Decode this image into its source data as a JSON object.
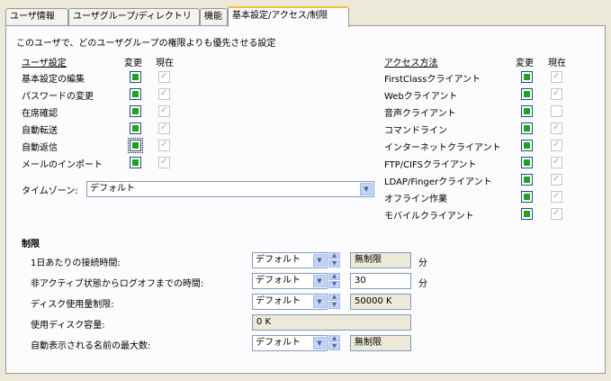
{
  "tabs": [
    {
      "label": "ユーザ情報"
    },
    {
      "label": "ユーザグループ/ディレクトリ"
    },
    {
      "label": "機能"
    },
    {
      "label": "基本設定/アクセス/制限"
    }
  ],
  "intro_text": "このユーザで、どのユーザグループの権限よりも優先させる設定",
  "user_settings": {
    "header": "ユーザ設定",
    "change_header": "変更",
    "current_header": "現在",
    "items": [
      {
        "label": "基本設定の編集",
        "change": true,
        "current": true
      },
      {
        "label": "パスワードの変更",
        "change": true,
        "current": true
      },
      {
        "label": "在席確認",
        "change": true,
        "current": true
      },
      {
        "label": "自動転送",
        "change": true,
        "current": true
      },
      {
        "label": "自動返信",
        "change": true,
        "current": true
      },
      {
        "label": "メールのインポート",
        "change": true,
        "current": true
      }
    ]
  },
  "access": {
    "header": "アクセス方法",
    "change_header": "変更",
    "current_header": "現在",
    "items": [
      {
        "label": "FirstClassクライアント",
        "change": true,
        "current": true
      },
      {
        "label": "Webクライアント",
        "change": true,
        "current": true
      },
      {
        "label": "音声クライアント",
        "change": true,
        "current": false
      },
      {
        "label": "コマンドライン",
        "change": true,
        "current": true
      },
      {
        "label": "インターネットクライアント",
        "change": true,
        "current": true
      },
      {
        "label": "FTP/CIFSクライアント",
        "change": true,
        "current": true
      },
      {
        "label": "LDAP/Fingerクライアント",
        "change": true,
        "current": true
      },
      {
        "label": "オフライン作業",
        "change": true,
        "current": true
      },
      {
        "label": "モバイルクライアント",
        "change": true,
        "current": true
      }
    ]
  },
  "timezone": {
    "label": "タイムゾーン:",
    "value": "デフォルト"
  },
  "limits": {
    "header": "制限",
    "rows": [
      {
        "label": "1日あたりの接続時間:",
        "select": "デフォルト",
        "value": "無制限",
        "unit": "分"
      },
      {
        "label": "非アクティブ状態からログオフまでの時間:",
        "select": "デフォルト",
        "value": "30",
        "unit": "分"
      },
      {
        "label": "ディスク使用量制限:",
        "select": "デフォルト",
        "value": "50000 K",
        "unit": ""
      },
      {
        "label": "使用ディスク容量:",
        "select": "",
        "value": "0 K",
        "unit": ""
      },
      {
        "label": "自動表示される名前の最大数:",
        "select": "デフォルト",
        "value": "無制限",
        "unit": ""
      }
    ]
  },
  "icons": {
    "dropdown": "▼",
    "spin_up": "▲",
    "spin_down": "▼",
    "check": "✓"
  }
}
